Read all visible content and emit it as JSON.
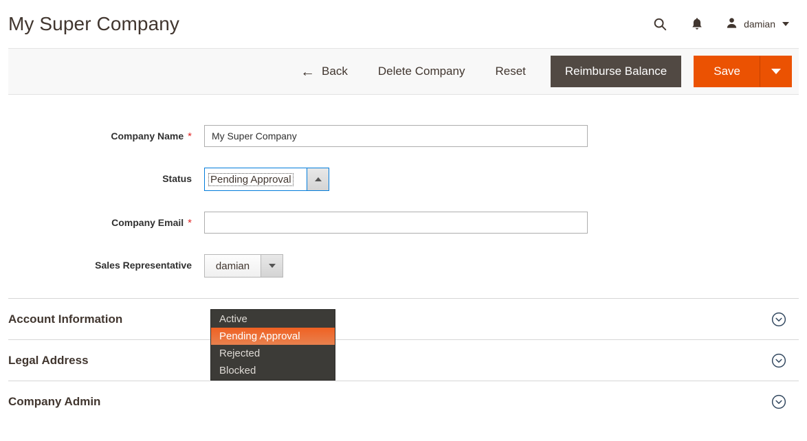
{
  "header": {
    "title": "My Super Company",
    "search_icon": "search-icon",
    "notifications_icon": "bell-icon",
    "user_icon": "user-avatar-icon",
    "user_name": "damian",
    "caret_icon": "chevron-down-icon"
  },
  "toolbar": {
    "back_icon": "arrow-left-icon",
    "back_label": "Back",
    "delete_label": "Delete Company",
    "reset_label": "Reset",
    "reimburse_label": "Reimburse Balance",
    "save_label": "Save",
    "save_toggle_icon": "chevron-down-icon"
  },
  "form": {
    "company_name": {
      "label": "Company Name",
      "required": "*",
      "value": "My Super Company",
      "placeholder": ""
    },
    "status": {
      "label": "Status",
      "value": "Pending Approval",
      "toggle_icon": "arrow-up-icon",
      "options": [
        {
          "label": "Active",
          "selected": false
        },
        {
          "label": "Pending Approval",
          "selected": true
        },
        {
          "label": "Rejected",
          "selected": false
        },
        {
          "label": "Blocked",
          "selected": false
        }
      ]
    },
    "company_email": {
      "label": "Company Email",
      "required": "*",
      "value": "",
      "placeholder": ""
    },
    "sales_representative": {
      "label": "Sales Representative",
      "value": "damian",
      "toggle_icon": "arrow-down-icon"
    }
  },
  "sections": [
    {
      "title": "Account Information",
      "icon": "chevron-down-circle-icon"
    },
    {
      "title": "Legal Address",
      "icon": "chevron-down-circle-icon"
    },
    {
      "title": "Company Admin",
      "icon": "chevron-down-circle-icon"
    }
  ],
  "colors": {
    "accent_orange": "#eb5202",
    "dark_button": "#514943",
    "focus_blue": "#007bdb",
    "required_red": "#e22626",
    "dropdown_bg": "#3c3b37",
    "dropdown_highlight": "#f06123"
  }
}
